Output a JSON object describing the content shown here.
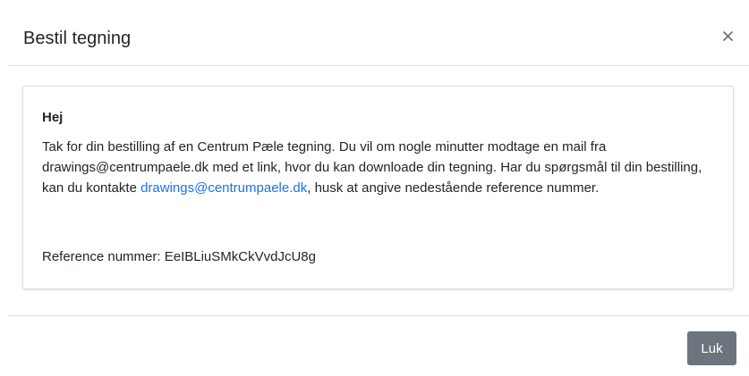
{
  "dialog": {
    "title": "Bestil tegning",
    "close_label": "×"
  },
  "body": {
    "greeting": "Hej",
    "message_part1": "Tak for din bestilling af en Centrum Pæle tegning. Du vil om nogle minutter modtage en mail fra drawings@centrumpaele.dk med et link, hvor du kan downloade din tegning. Har du spørgsmål til din bestilling, kan du kontakte ",
    "message_link": "drawings@centrumpaele.dk",
    "message_part2": ", husk at angive nedestående reference nummer.",
    "reference_label": "Reference nummer:",
    "reference_value": "EeIBLiuSMkCkVvdJcU8g"
  },
  "footer": {
    "close_button_label": "Luk"
  },
  "colors": {
    "link": "#1a73e8",
    "button_bg": "#6c757d",
    "border": "#dee2e6",
    "text": "#212529"
  },
  "icons": {
    "close": "close-icon"
  }
}
